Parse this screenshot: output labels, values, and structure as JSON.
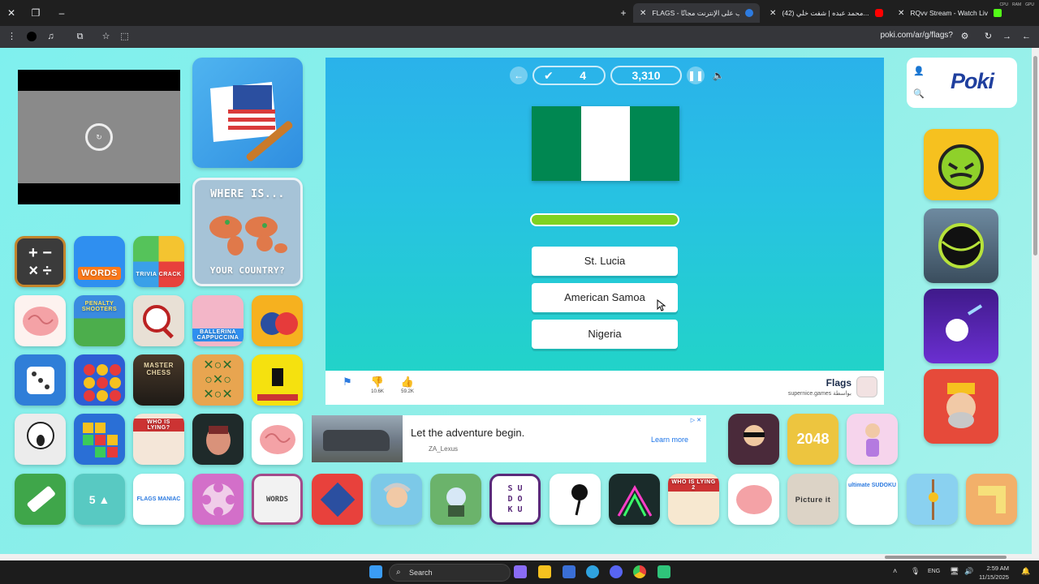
{
  "browser": {
    "tabs": [
      {
        "title": "FLAGS - العب على الإنترنت مجانًا",
        "active": true,
        "favicon_color": "#2d7be0"
      },
      {
        "title": "(42) محمد عبده | شفت خلي...",
        "active": false,
        "favicon_color": "#ff0000"
      },
      {
        "title": "RQvv Stream - Watch Live on",
        "active": false,
        "favicon_color": "#53fc18"
      }
    ],
    "new_tab_symbol": "+",
    "url": "poki.com/ar/g/flags?",
    "system_mini": [
      "CPU",
      "RAM",
      "GPU"
    ]
  },
  "game": {
    "correct_count": "4",
    "score": "3,310",
    "flag_colors": [
      "#008751",
      "#ffffff",
      "#008751"
    ],
    "progress": 1.0,
    "progress_color": "#7fd221",
    "answers": [
      {
        "label": "St. Lucia"
      },
      {
        "label": "American Samoa"
      },
      {
        "label": "Nigeria"
      }
    ],
    "footer": {
      "dislikes": "10.6K",
      "likes": "59.2K",
      "title": "Flags",
      "developer": "supernice.games بواسطة"
    }
  },
  "sidebar_tiles": {
    "big_top": "WHERE IS...",
    "big_bottom": "YOUR COUNTRY?",
    "words": "WORDS",
    "trivia": "TRIVIA CRACK",
    "penalty": "PENALTY SHOOTERS",
    "ballerina": "BALLERINA CAPPUCCINA",
    "master": "MASTER CHESS",
    "lying": "WHO IS LYING?",
    "tile_2048": "2048",
    "flags_maniac": "FLAGS MANIAC",
    "sudoku_col": [
      "S U",
      "D O",
      "K U"
    ],
    "lying2": "WHO IS LYING 2",
    "picture": "Picture it",
    "ultimate": "ultimate SUDOKU",
    "words_grid": "WORDS"
  },
  "ad": {
    "headline": "Let the adventure begin.",
    "brand": "ZA_Lexus",
    "cta": "Learn more"
  },
  "taskbar": {
    "search_label": "Search",
    "lang": "ENG",
    "time": "2:59 AM",
    "date": "11/15/2025"
  }
}
